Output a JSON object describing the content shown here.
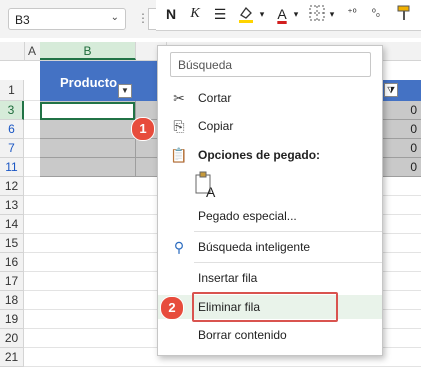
{
  "name_box": {
    "value": "B3"
  },
  "toolbar": {
    "bold_label": "N",
    "italic_label": "K",
    "font_color_label": "A",
    "colors": {
      "fill": "#ffd400",
      "font": "#d21f1f"
    }
  },
  "columns": [
    "A",
    "B"
  ],
  "rows": [
    {
      "label": "1",
      "state": "normal"
    },
    {
      "label": "3",
      "state": "selected"
    },
    {
      "label": "6",
      "state": "blue"
    },
    {
      "label": "7",
      "state": "blue"
    },
    {
      "label": "11",
      "state": "blue"
    },
    {
      "label": "12",
      "state": "normal"
    },
    {
      "label": "13",
      "state": "normal"
    },
    {
      "label": "14",
      "state": "normal"
    },
    {
      "label": "15",
      "state": "normal"
    },
    {
      "label": "16",
      "state": "normal"
    },
    {
      "label": "17",
      "state": "normal"
    },
    {
      "label": "18",
      "state": "normal"
    },
    {
      "label": "19",
      "state": "normal"
    },
    {
      "label": "20",
      "state": "normal"
    },
    {
      "label": "21",
      "state": "normal"
    }
  ],
  "table": {
    "header": "Producto",
    "right_values": [
      "0",
      "0",
      "0",
      "0"
    ]
  },
  "context_menu": {
    "search_placeholder": "Búsqueda",
    "items": [
      {
        "label": "Cortar",
        "icon": "scissors-icon"
      },
      {
        "label": "Copiar",
        "icon": "copy-icon"
      },
      {
        "label": "Opciones de pegado:",
        "icon": "clipboard-icon"
      },
      {
        "label": "Pegado especial...",
        "icon": ""
      },
      {
        "label": "Búsqueda inteligente",
        "icon": "smart-lookup-icon"
      },
      {
        "label": "Insertar fila",
        "icon": ""
      },
      {
        "label": "Eliminar fila",
        "icon": ""
      },
      {
        "label": "Borrar contenido",
        "icon": ""
      }
    ]
  },
  "badges": [
    "1",
    "2"
  ],
  "accent_colors": {
    "excel_green": "#217346",
    "table_blue": "#4472c4",
    "badge_red": "#e74c3c"
  }
}
